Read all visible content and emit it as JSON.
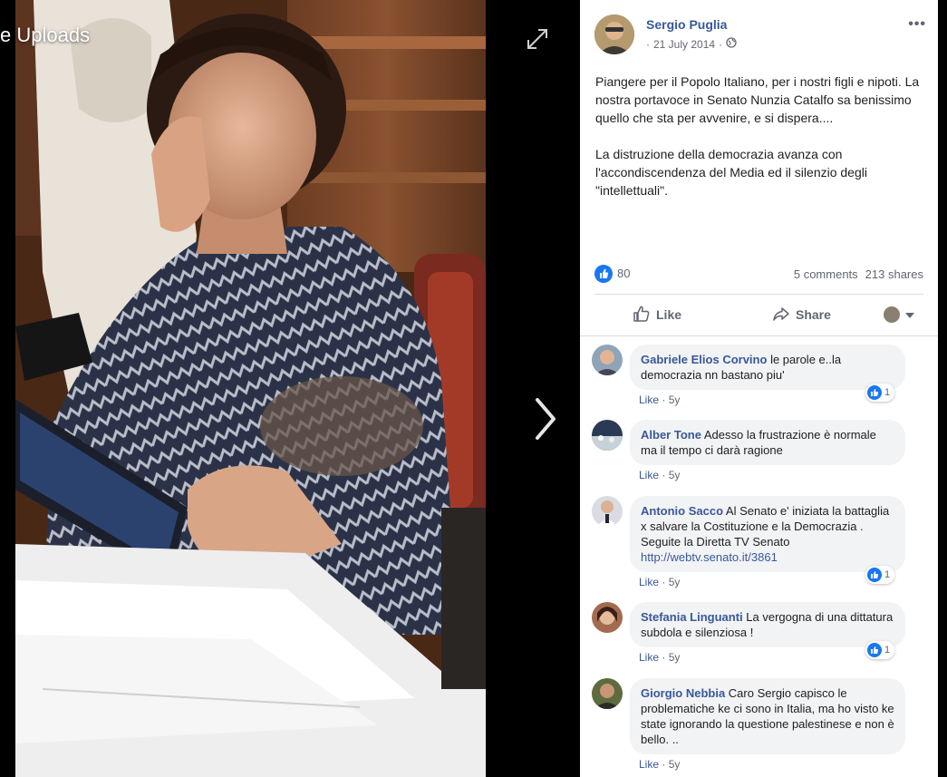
{
  "album": {
    "title": "e Uploads"
  },
  "post": {
    "author": "Sergio Puglia",
    "date": "21 July 2014",
    "separator": "·",
    "more_label": "•••",
    "paragraphs": [
      "Piangere per il Popolo Italiano, per i nostri figli e nipoti. La nostra portavoce in Senato Nunzia Catalfo sa benissimo quello che sta per avvenire, e si dispera....",
      "La distruzione della democrazia avanza con l'accondiscendenza del Media ed il silenzio degli \"intellettuali\"."
    ],
    "likes": "80",
    "comments_count": "5 comments",
    "shares_count": "213 shares",
    "actions": {
      "like": "Like",
      "share": "Share"
    }
  },
  "comments": [
    {
      "name": "Gabriele Elios Corvino",
      "text": "le parole e..la democrazia nn bastano piu'",
      "like": "Like",
      "age": "5y",
      "reactions": "1"
    },
    {
      "name": "Alber Tone",
      "text": "Adesso la frustrazione è normale ma il tempo ci darà ragione",
      "like": "Like",
      "age": "5y",
      "reactions": ""
    },
    {
      "name": "Antonio Sacco",
      "text": "Al Senato e' iniziata la battaglia x salvare la Costituzione e la Democrazia . Seguite la Diretta TV Senato",
      "link": "http://webtv.senato.it/3861",
      "like": "Like",
      "age": "5y",
      "reactions": "1"
    },
    {
      "name": "Stefania Linguanti",
      "text": "La vergogna di una dittatura subdola e silenziosa !",
      "like": "Like",
      "age": "5y",
      "reactions": "1"
    },
    {
      "name": "Giorgio Nebbia",
      "text": "Caro Sergio capisco le problematiche ke ci sono in Italia, ma ho visto ke state ignorando la questione palestinese e non è bello. ..",
      "like": "Like",
      "age": "5y",
      "reactions": ""
    }
  ],
  "colors": {
    "link": "#385898",
    "muted": "#606770",
    "bubble": "#f2f3f5",
    "like_blue": "#1877f2"
  },
  "icons": [
    "expand-icon",
    "chevron-right-icon",
    "globe-icon",
    "thumbs-up-icon",
    "share-icon",
    "caret-down-icon"
  ]
}
